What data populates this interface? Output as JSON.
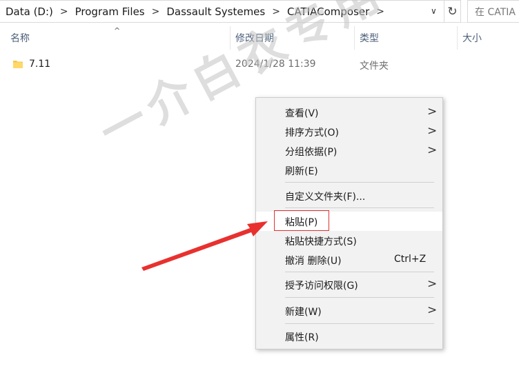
{
  "address": {
    "crumbs": [
      "Data (D:)",
      "Program Files",
      "Dassault Systemes",
      "CATIAComposer"
    ],
    "separator": ">",
    "dropdown": "∨",
    "refresh": "↻",
    "search_text": "在 CATIA"
  },
  "columns": {
    "name": "名称",
    "date": "修改日期",
    "type": "类型",
    "size": "大小",
    "sort_indicator": "^"
  },
  "files": [
    {
      "name": "7.11",
      "date": "2024/1/28 11:39",
      "type": "文件夹",
      "icon": "folder-icon"
    }
  ],
  "watermark": "一介白衣专用",
  "context_menu": {
    "chevron": ">",
    "view": "查看(V)",
    "sort": "排序方式(O)",
    "group": "分组依据(P)",
    "refresh": "刷新(E)",
    "customize": "自定义文件夹(F)...",
    "paste": "粘贴(P)",
    "paste_shortcut": "粘贴快捷方式(S)",
    "undo_delete": "撤消 删除(U)",
    "undo_shortcut": "Ctrl+Z",
    "grant_access": "授予访问权限(G)",
    "new": "新建(W)",
    "properties": "属性(R)"
  },
  "colors": {
    "header_text": "#4c607a",
    "highlight_box": "#e03030",
    "arrow": "#e8312f",
    "folder": "#f6c64a"
  }
}
